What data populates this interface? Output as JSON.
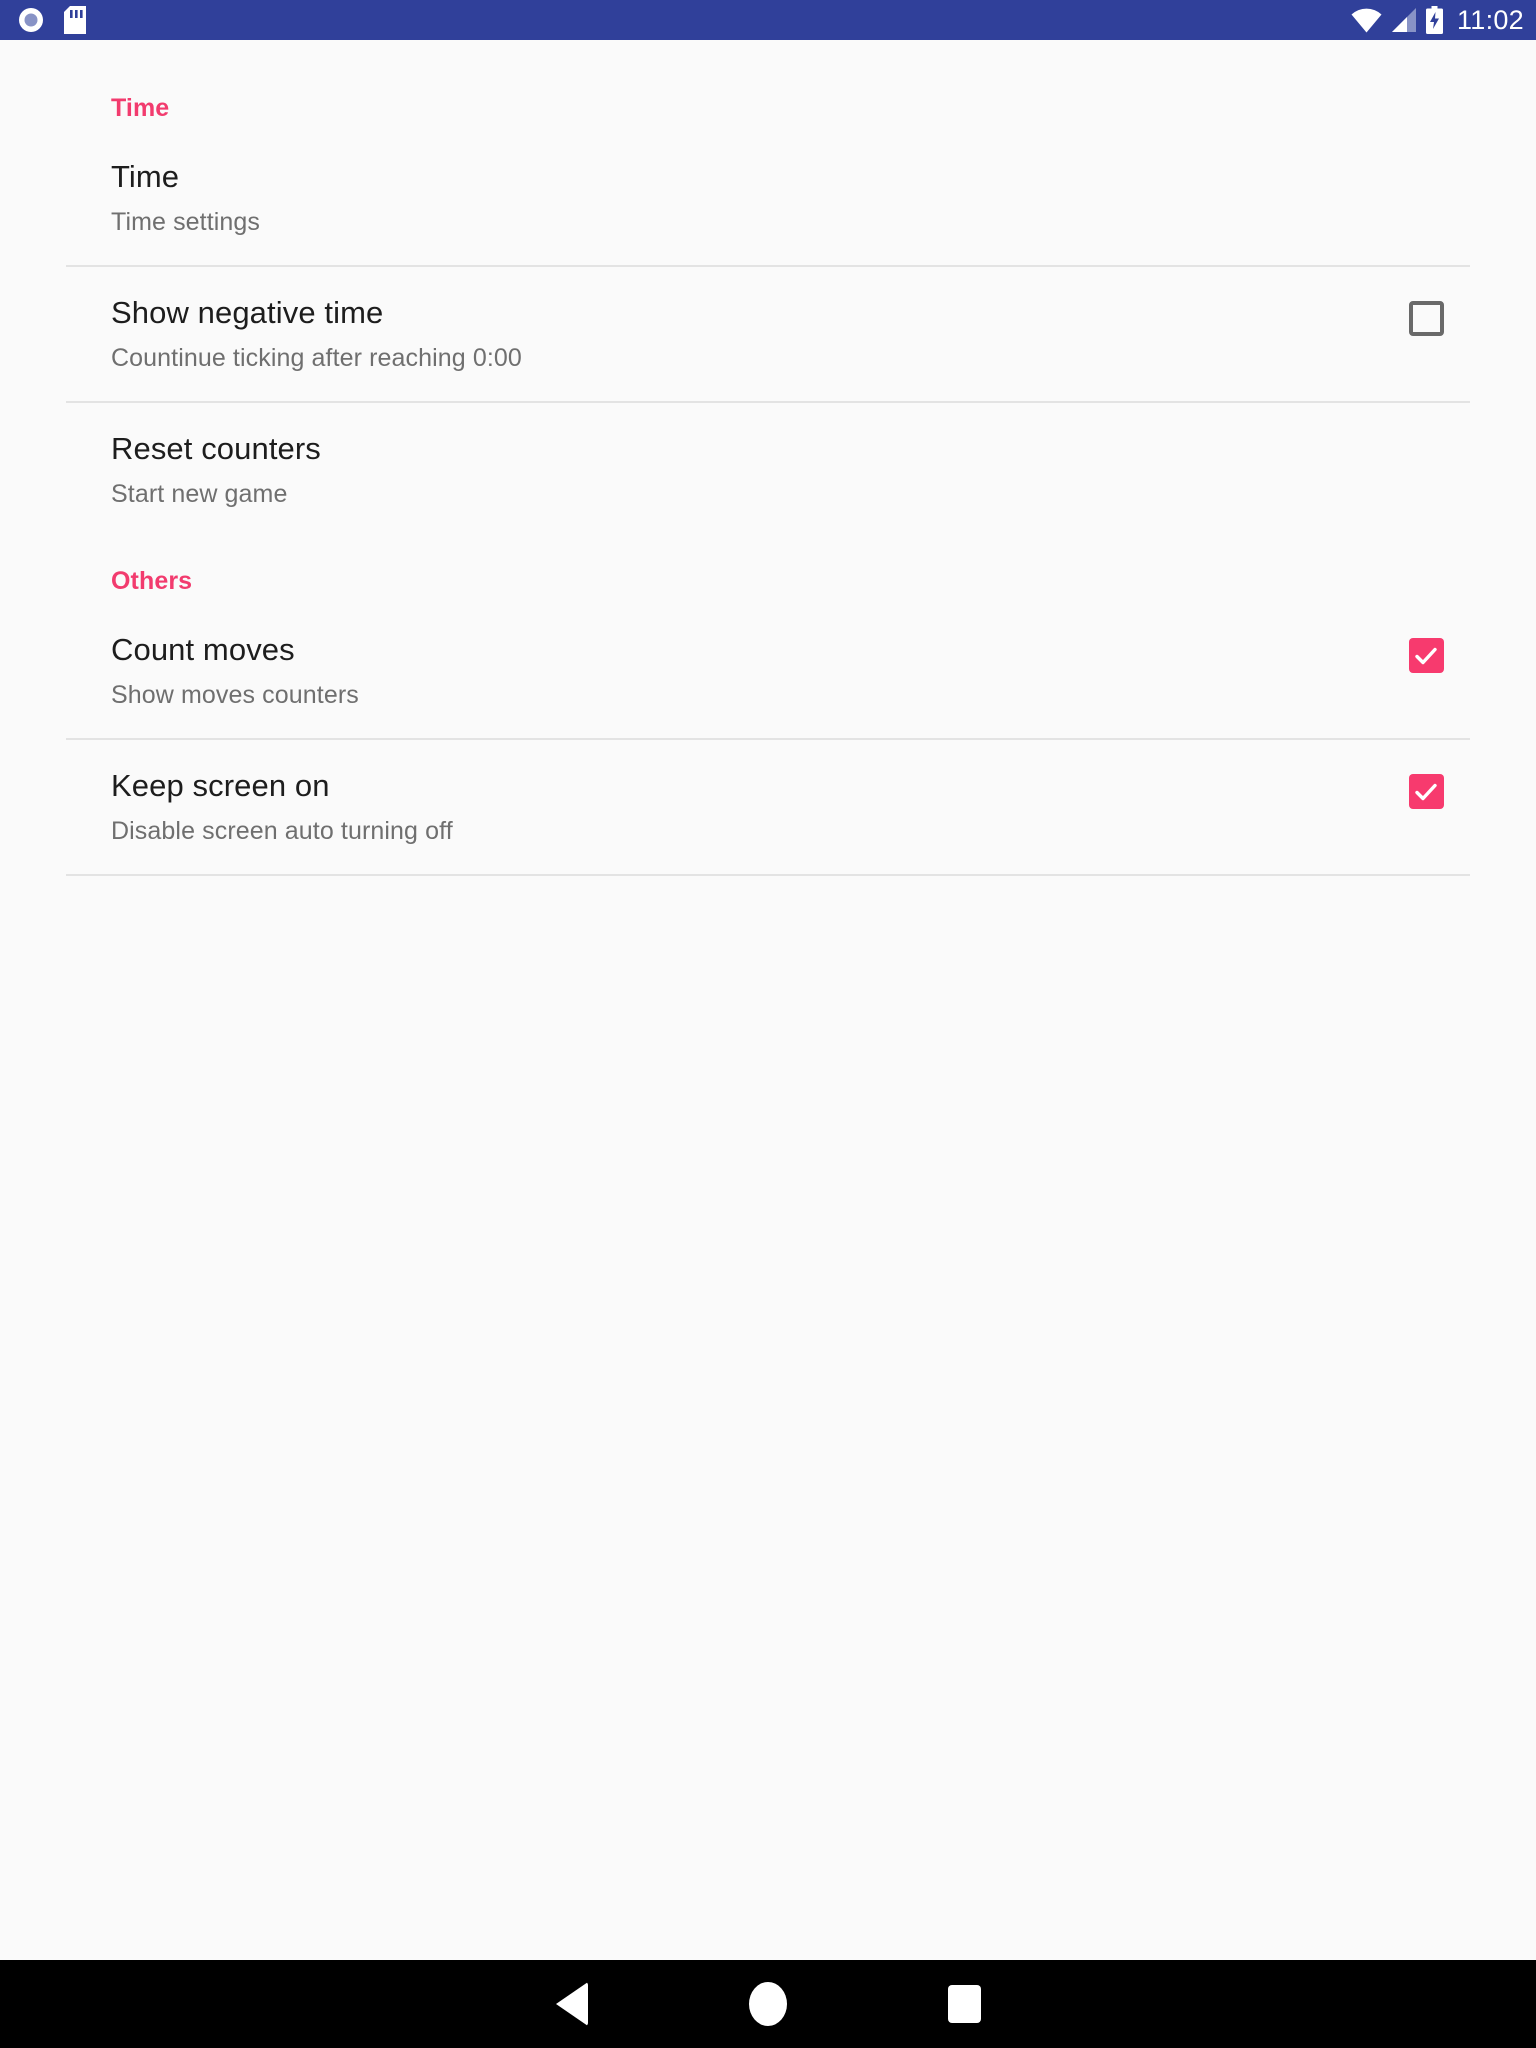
{
  "status_bar": {
    "background_color": "#30409a",
    "left_icons": [
      {
        "name": "screen-record-icon",
        "glyph": "circle"
      },
      {
        "name": "sd-card-icon",
        "glyph": "sd-card"
      }
    ],
    "right_icons": [
      {
        "name": "wifi-icon",
        "glyph": "wifi"
      },
      {
        "name": "cellular-signal-icon",
        "glyph": "signal"
      },
      {
        "name": "battery-charging-icon",
        "glyph": "battery-bolt"
      }
    ],
    "clock": "11:02"
  },
  "settings": {
    "accent_color": "#f23b6e",
    "sections": [
      {
        "header": "Time",
        "items": [
          {
            "title": "Time",
            "summary": "Time settings",
            "widget": "none",
            "checked": false
          },
          {
            "title": "Show negative time",
            "summary": "Countinue ticking after reaching 0:00",
            "widget": "checkbox",
            "checked": false
          },
          {
            "title": "Reset counters",
            "summary": "Start new game",
            "widget": "none",
            "checked": false
          }
        ]
      },
      {
        "header": "Others",
        "items": [
          {
            "title": "Count moves",
            "summary": "Show moves counters",
            "widget": "checkbox",
            "checked": true
          },
          {
            "title": "Keep screen on",
            "summary": "Disable screen auto turning off",
            "widget": "checkbox",
            "checked": true
          }
        ]
      }
    ]
  },
  "nav_bar": {
    "background_color": "#000000",
    "buttons": [
      {
        "name": "nav-back-button",
        "label": "Back"
      },
      {
        "name": "nav-home-button",
        "label": "Home"
      },
      {
        "name": "nav-recents-button",
        "label": "Recents"
      }
    ]
  }
}
